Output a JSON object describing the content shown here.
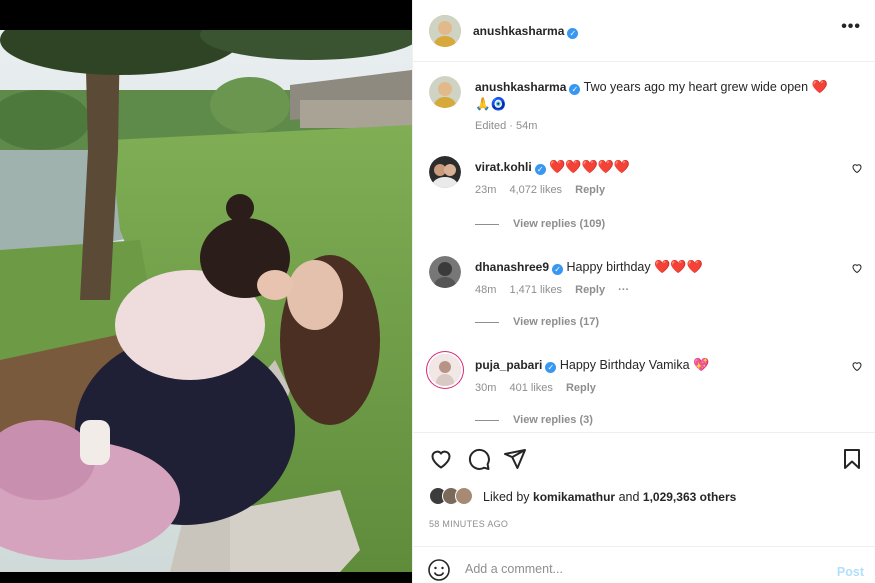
{
  "post": {
    "author": "anushkasharma",
    "caption": "Two years ago my heart grew wide open",
    "caption_emoji_1": "❤️",
    "caption_emoji_2": "🙏🧿",
    "edited": "Edited · 54m"
  },
  "comments": [
    {
      "user": "virat.kohli",
      "text": "❤️❤️❤️❤️❤️",
      "time": "23m",
      "likes": "4,072 likes",
      "reply": "Reply",
      "view_replies": "View replies (109)"
    },
    {
      "user": "dhanashree9",
      "text": "Happy birthday",
      "text_emoji": "❤️❤️❤️",
      "time": "48m",
      "likes": "1,471 likes",
      "reply": "Reply",
      "more": "···",
      "view_replies": "View replies (17)"
    },
    {
      "user": "puja_pabari",
      "text": "Happy Birthday Vamika",
      "text_emoji": "💖",
      "time": "30m",
      "likes": "401 likes",
      "reply": "Reply",
      "view_replies": "View replies (3)"
    }
  ],
  "likes": {
    "prefix": "Liked by",
    "user": "komikamathur",
    "middle": "and",
    "count": "1,029,363 others"
  },
  "timestamp": "58 MINUTES AGO",
  "comment_input": {
    "placeholder": "Add a comment...",
    "post_label": "Post"
  },
  "colors": {
    "verified": "#3897f0",
    "heart": "#ed1c3c",
    "post_disabled": "#b2dffc"
  },
  "icons": [
    "more-icon",
    "heart-icon",
    "comment-icon",
    "share-icon",
    "bookmark-icon",
    "emoji-icon",
    "verified-icon"
  ]
}
